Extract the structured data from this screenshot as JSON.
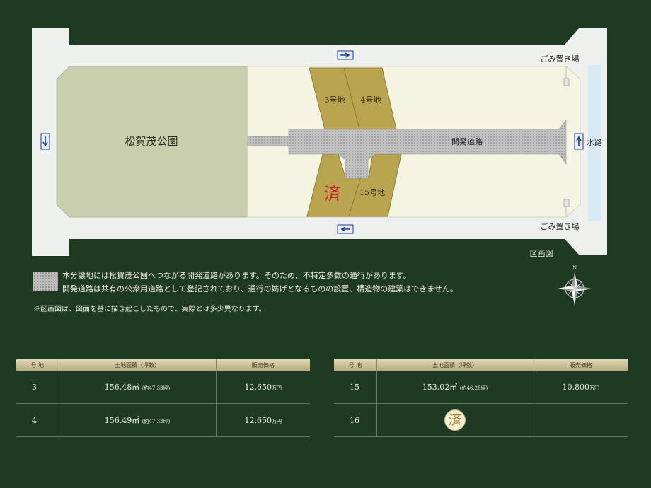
{
  "map": {
    "park_label": "松賀茂公園",
    "lot_3_label": "3号地",
    "lot_4_label": "4号地",
    "lot_15_label": "15号地",
    "lot_16_sold_mark": "済",
    "dev_road_label": "開発道路",
    "waterway_label": "水路",
    "garbage_top": "ごみ置き場",
    "garbage_bottom": "ごみ置き場",
    "map_caption": "区画図",
    "compass_north": "N"
  },
  "notes": {
    "line1": "本分譲地には松賀茂公園へつながる開発道路があります。そのため、不特定多数の通行があります。",
    "line2": "開発道路は共有の公衆用道路として登記されており、通行の妨げとなるものの設置、構造物の建築はできません。",
    "line3": "※区画図は、図面を基に描き起こしたもので、実際とは多少異なります。"
  },
  "table_left": {
    "headers": [
      "号 地",
      "土地面積（坪数）",
      "販売価格"
    ],
    "rows": [
      {
        "lot": "3",
        "area": "156.48㎡",
        "tsubo": "(約47.33坪)",
        "price": "12,650",
        "unit": "万円"
      },
      {
        "lot": "4",
        "area": "156.49㎡",
        "tsubo": "(約47.33坪)",
        "price": "12,650",
        "unit": "万円"
      }
    ]
  },
  "table_right": {
    "headers": [
      "号 地",
      "土地面積（坪数）",
      "販売価格"
    ],
    "rows": [
      {
        "lot": "15",
        "area": "153.02㎡",
        "tsubo": "(約46.28坪)",
        "price": "10,800",
        "unit": "万円"
      },
      {
        "lot": "16",
        "sold": "済"
      }
    ]
  },
  "colors": {
    "background": "#1f3a22",
    "road": "#eef0ee",
    "park": "#c9cfae",
    "site": "#f5f3e1",
    "lot": "#b9a550",
    "waterway": "#d6e9f5",
    "sold_red": "#c8202a"
  }
}
